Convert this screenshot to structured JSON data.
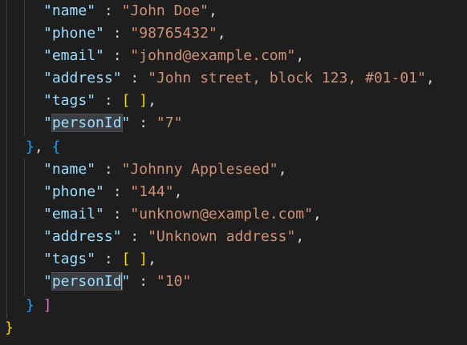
{
  "editor": {
    "colors": {
      "background": "#1e1e1e",
      "key": "#9cdcfe",
      "string": "#ce9178",
      "bracket_outer": "#ffd700",
      "bracket_array": "#da70d6",
      "bracket_object": "#179fff",
      "highlight": "#3a3d41"
    },
    "entry1": {
      "name_key": "name",
      "name_val": "John Doe",
      "phone_key": "phone",
      "phone_val": "98765432",
      "email_key": "email",
      "email_val": "johnd@example.com",
      "address_key": "address",
      "address_val": "John street, block 123, #01-01",
      "tags_key": "tags",
      "personid_key": "personId",
      "personid_val": "7"
    },
    "entry2": {
      "name_key": "name",
      "name_val": "Johnny Appleseed",
      "phone_key": "phone",
      "phone_val": "144",
      "email_key": "email",
      "email_val": "unknown@example.com",
      "address_key": "address",
      "address_val": "Unknown address",
      "tags_key": "tags",
      "personid_key": "personId",
      "personid_val": "10"
    }
  }
}
